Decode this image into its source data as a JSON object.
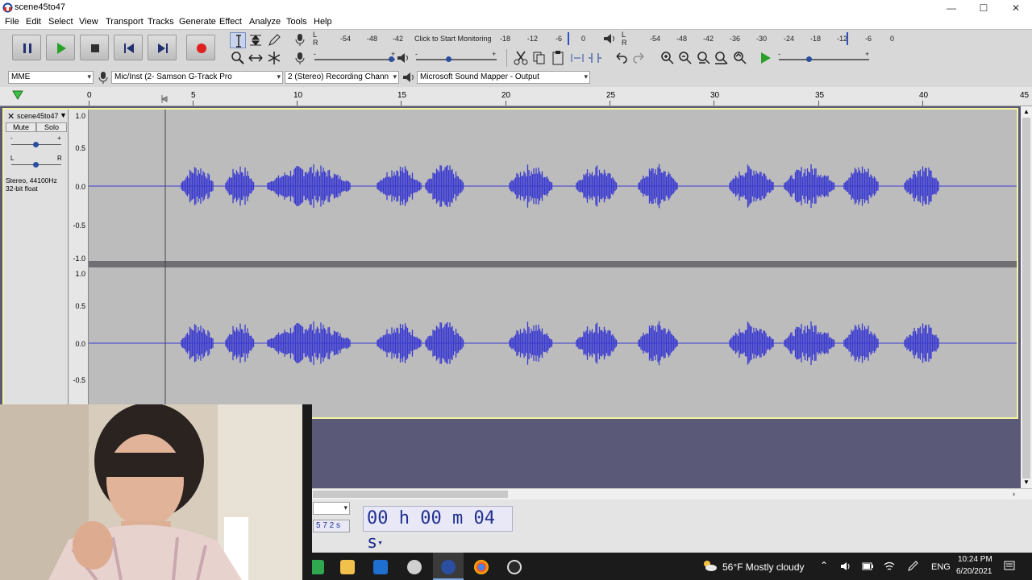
{
  "window": {
    "title": "scene45to47",
    "minimize": "—",
    "maximize": "☐",
    "close": "✕"
  },
  "menu": [
    "File",
    "Edit",
    "Select",
    "View",
    "Transport",
    "Tracks",
    "Generate",
    "Effect",
    "Analyze",
    "Tools",
    "Help"
  ],
  "meters": {
    "record_scale": [
      "-54",
      "-48",
      "-42",
      "-18",
      "-12",
      "-6",
      "0"
    ],
    "monitor_label": "Click to Start Monitoring",
    "playback_scale": [
      "-54",
      "-48",
      "-42",
      "-36",
      "-30",
      "-24",
      "-18",
      "-12",
      "-6",
      "0"
    ],
    "lr_left": "L",
    "lr_right": "R"
  },
  "slider_marks": {
    "minus": "-",
    "plus": "+"
  },
  "device": {
    "host": "MME",
    "input": "Mic/Inst (2- Samson G-Track Pro",
    "channels": "2 (Stereo) Recording Chann",
    "output": "Microsoft Sound Mapper - Output"
  },
  "timeline": {
    "ticks": [
      "0",
      "5",
      "10",
      "15",
      "20",
      "25",
      "30",
      "35",
      "40",
      "45"
    ]
  },
  "track": {
    "name": "scene45to47",
    "mute": "Mute",
    "solo": "Solo",
    "gain_minus": "-",
    "gain_plus": "+",
    "pan_left": "L",
    "pan_right": "R",
    "info_line1": "Stereo, 44100Hz",
    "info_line2": "32-bit float",
    "scale_top": [
      "1.0",
      "0.5",
      "0.0",
      "-0.5",
      "-1.0"
    ],
    "scale_bottom": [
      "1.0",
      "0.5",
      "0.0",
      "-0.5"
    ]
  },
  "selection": {
    "field_suffix": "5 7 2 s",
    "time": "00 h 00 m 04 s"
  },
  "tray": {
    "weather": "56°F  Mostly cloudy",
    "lang": "ENG",
    "time": "10:24 PM",
    "date": "6/20/2021"
  },
  "colors": {
    "waveform": "#3a3ad0",
    "track_bg": "#bcbcbc",
    "track_border": "#f3f3a0",
    "void_bg": "#5a5a78"
  }
}
